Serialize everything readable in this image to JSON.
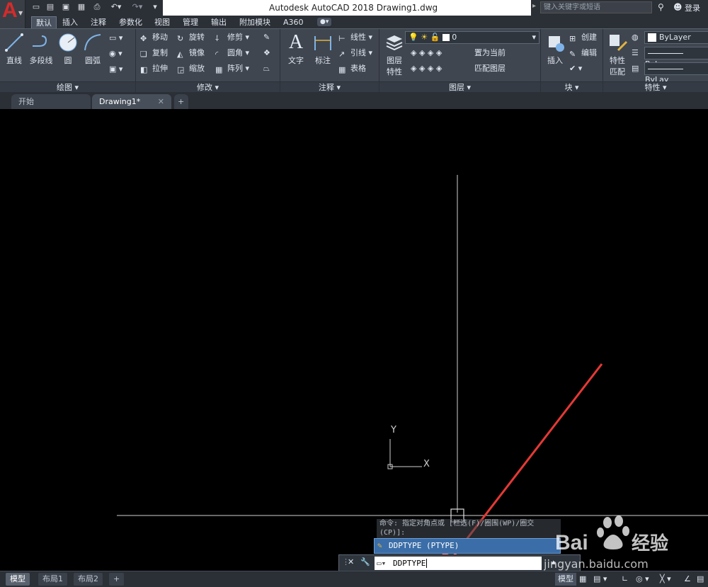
{
  "titlebar": {
    "app_title": "Autodesk AutoCAD 2018    Drawing1.dwg",
    "search_placeholder": "键入关键字或短语",
    "login_label": "登录"
  },
  "ribbon_tabs": [
    "默认",
    "插入",
    "注释",
    "参数化",
    "视图",
    "管理",
    "输出",
    "附加模块",
    "A360"
  ],
  "active_ribbon_tab": "默认",
  "panels": {
    "draw": {
      "footer": "绘图 ▾",
      "buttons": [
        "直线",
        "多段线",
        "圆",
        "圆弧"
      ]
    },
    "modify": {
      "footer": "修改 ▾",
      "buttons": [
        "移动",
        "旋转",
        "修剪",
        "复制",
        "镜像",
        "圆角",
        "拉伸",
        "缩放",
        "阵列"
      ]
    },
    "annotation": {
      "footer": "注释 ▾",
      "buttons": [
        "文字",
        "标注",
        "线性",
        "引线",
        "表格"
      ]
    },
    "layers": {
      "footer": "图层 ▾",
      "big_button_line1": "图层",
      "big_button_line2": "特性",
      "layer_value": "0",
      "buttons": [
        "置为当前",
        "匹配图层"
      ]
    },
    "block": {
      "footer": "块 ▾",
      "buttons": [
        "插入",
        "创建",
        "编辑"
      ]
    },
    "properties": {
      "footer": "特性 ▾",
      "big_button_line1": "特性",
      "big_button_line2": "匹配",
      "color_value": "ByLayer",
      "linetype_value": "ByLay",
      "lineweight_value": "ByLay"
    }
  },
  "file_tabs": [
    {
      "label": "开始"
    },
    {
      "label": "Drawing1*"
    }
  ],
  "canvas": {
    "ucs_y": "Y",
    "ucs_x": "X"
  },
  "command": {
    "history_line1": "命令: 指定对角点或 [栏选(F)/圈围(WP)/圈交",
    "history_line2": "(CP)]:",
    "autocomplete": "DDPTYPE (PTYPE)",
    "input_value": "DDPTYPE"
  },
  "statusbar": {
    "layout_tabs": [
      "模型",
      "布局1",
      "布局2"
    ],
    "add_tab": "+",
    "model_label": "模型"
  },
  "watermark": {
    "brand": "Bai",
    "brand2": "经验",
    "url": "jingyan.baidu.com"
  },
  "colors": {
    "accent_blue": "#3b6ea8",
    "arrow_red": "#e53935",
    "logo_red": "#d42b2b"
  }
}
